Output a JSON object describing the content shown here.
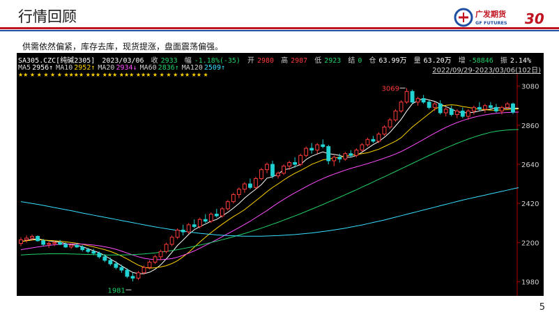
{
  "slide": {
    "title": "行情回顾",
    "summary": "供需依然偏紧，库存去库，现货提涨，盘面震荡偏强。",
    "page_number": "5",
    "logo_text": "广发期货",
    "logo_sub": "GF FUTURES",
    "logo_anniv": "30"
  },
  "quote": {
    "symbol": "SA305.CZC[纯碱2305]",
    "date": "2023/03/06",
    "close_label": "收",
    "close": "2933",
    "change_label": "幅",
    "change": "-1.18%(-35)",
    "open_label": "开",
    "open": "2980",
    "high_label": "高",
    "high": "2987",
    "low_label": "低",
    "low": "2923",
    "settle_label": "结",
    "settle": "0",
    "oi_label": "仓",
    "oi": "63.99万",
    "vol_label": "量",
    "vol": "63.20万",
    "diff_label": "增",
    "diff": "-58846",
    "amp_label": "振",
    "amp": "2.14%"
  },
  "ma_legend": [
    {
      "label": "MA5",
      "value": "2956↑",
      "color": "#ffffff"
    },
    {
      "label": "MA10",
      "value": "2952↑",
      "color": "#ffd400"
    },
    {
      "label": "MA20",
      "value": "2934↓",
      "color": "#ff4dff"
    },
    {
      "label": "MA60",
      "value": "2836↑",
      "color": "#22d36a"
    },
    {
      "label": "MA120",
      "value": "2509↑",
      "color": "#38e0ff"
    }
  ],
  "date_range": "2022/09/29-2023/03/06(102日)",
  "chart_data": {
    "type": "candlestick",
    "ylim": [
      1900,
      3110
    ],
    "y_ticks": [
      "3080",
      "2860",
      "2640",
      "2420",
      "2200",
      "1980"
    ],
    "annotations": [
      {
        "text": "3069",
        "index": 69,
        "value": 3069,
        "color": "#ff3b3b"
      },
      {
        "text": "1981",
        "index": 20,
        "value": 1981,
        "color": "#22d36a"
      }
    ],
    "up_color": "#ff3b3b",
    "down_color": "#22d3d3",
    "candles": [
      [
        2195,
        2230,
        2180,
        2215
      ],
      [
        2215,
        2240,
        2200,
        2225
      ],
      [
        2225,
        2245,
        2210,
        2235
      ],
      [
        2235,
        2240,
        2205,
        2210
      ],
      [
        2210,
        2220,
        2180,
        2190
      ],
      [
        2190,
        2205,
        2170,
        2195
      ],
      [
        2195,
        2210,
        2180,
        2200
      ],
      [
        2200,
        2215,
        2185,
        2190
      ],
      [
        2190,
        2200,
        2170,
        2175
      ],
      [
        2175,
        2190,
        2165,
        2185
      ],
      [
        2185,
        2195,
        2170,
        2175
      ],
      [
        2175,
        2185,
        2150,
        2160
      ],
      [
        2160,
        2170,
        2140,
        2150
      ],
      [
        2150,
        2165,
        2130,
        2140
      ],
      [
        2140,
        2150,
        2110,
        2120
      ],
      [
        2120,
        2135,
        2090,
        2100
      ],
      [
        2100,
        2115,
        2070,
        2080
      ],
      [
        2080,
        2095,
        2050,
        2060
      ],
      [
        2060,
        2075,
        2030,
        2045
      ],
      [
        2045,
        2055,
        2000,
        2010
      ],
      [
        2010,
        2030,
        1981,
        2000
      ],
      [
        2000,
        2040,
        1990,
        2030
      ],
      [
        2030,
        2070,
        2020,
        2060
      ],
      [
        2060,
        2100,
        2050,
        2090
      ],
      [
        2090,
        2130,
        2080,
        2120
      ],
      [
        2120,
        2160,
        2100,
        2150
      ],
      [
        2150,
        2200,
        2140,
        2190
      ],
      [
        2190,
        2240,
        2180,
        2230
      ],
      [
        2230,
        2280,
        2220,
        2270
      ],
      [
        2270,
        2300,
        2240,
        2260
      ],
      [
        2260,
        2310,
        2250,
        2300
      ],
      [
        2300,
        2330,
        2280,
        2290
      ],
      [
        2290,
        2340,
        2280,
        2330
      ],
      [
        2330,
        2360,
        2310,
        2320
      ],
      [
        2320,
        2370,
        2310,
        2360
      ],
      [
        2360,
        2390,
        2340,
        2350
      ],
      [
        2350,
        2400,
        2340,
        2390
      ],
      [
        2390,
        2440,
        2380,
        2430
      ],
      [
        2430,
        2480,
        2420,
        2470
      ],
      [
        2470,
        2510,
        2450,
        2500
      ],
      [
        2500,
        2540,
        2480,
        2530
      ],
      [
        2530,
        2560,
        2500,
        2510
      ],
      [
        2510,
        2570,
        2500,
        2560
      ],
      [
        2560,
        2620,
        2550,
        2610
      ],
      [
        2610,
        2650,
        2590,
        2640
      ],
      [
        2640,
        2660,
        2560,
        2575
      ],
      [
        2575,
        2600,
        2560,
        2590
      ],
      [
        2590,
        2640,
        2580,
        2630
      ],
      [
        2630,
        2660,
        2610,
        2650
      ],
      [
        2650,
        2680,
        2620,
        2640
      ],
      [
        2640,
        2700,
        2630,
        2690
      ],
      [
        2690,
        2740,
        2680,
        2730
      ],
      [
        2730,
        2760,
        2700,
        2720
      ],
      [
        2720,
        2760,
        2700,
        2750
      ],
      [
        2750,
        2780,
        2730,
        2740
      ],
      [
        2740,
        2750,
        2640,
        2660
      ],
      [
        2660,
        2690,
        2630,
        2680
      ],
      [
        2680,
        2700,
        2650,
        2670
      ],
      [
        2670,
        2710,
        2660,
        2700
      ],
      [
        2700,
        2720,
        2680,
        2690
      ],
      [
        2690,
        2730,
        2680,
        2720
      ],
      [
        2720,
        2760,
        2710,
        2750
      ],
      [
        2750,
        2790,
        2740,
        2780
      ],
      [
        2780,
        2800,
        2760,
        2770
      ],
      [
        2770,
        2820,
        2760,
        2810
      ],
      [
        2810,
        2860,
        2800,
        2850
      ],
      [
        2850,
        2900,
        2840,
        2890
      ],
      [
        2890,
        2950,
        2880,
        2940
      ],
      [
        2940,
        3000,
        2930,
        2990
      ],
      [
        2990,
        3069,
        2980,
        3050
      ],
      [
        3050,
        3060,
        2980,
        2990
      ],
      [
        2990,
        3020,
        2970,
        3010
      ],
      [
        3010,
        3030,
        2980,
        2990
      ],
      [
        2990,
        3000,
        2950,
        2960
      ],
      [
        2960,
        2990,
        2940,
        2980
      ],
      [
        2980,
        3000,
        2920,
        2930
      ],
      [
        2930,
        2960,
        2910,
        2950
      ],
      [
        2950,
        2970,
        2910,
        2920
      ],
      [
        2920,
        2950,
        2900,
        2940
      ],
      [
        2940,
        2960,
        2900,
        2910
      ],
      [
        2910,
        2950,
        2890,
        2940
      ],
      [
        2940,
        2970,
        2920,
        2960
      ],
      [
        2960,
        2990,
        2940,
        2950
      ],
      [
        2950,
        2980,
        2930,
        2970
      ],
      [
        2970,
        2990,
        2950,
        2960
      ],
      [
        2960,
        2980,
        2930,
        2940
      ],
      [
        2940,
        2970,
        2920,
        2960
      ],
      [
        2960,
        2990,
        2950,
        2980
      ],
      [
        2980,
        2987,
        2923,
        2933
      ]
    ],
    "ma": {
      "MA5": {
        "color": "#ffffff",
        "values": [
          2205,
          2212,
          2218,
          2221,
          2215,
          2210,
          2206,
          2202,
          2194,
          2188,
          2185,
          2177,
          2165,
          2154,
          2143,
          2127,
          2108,
          2089,
          2069,
          2050,
          2032,
          2025,
          2025,
          2033,
          2050,
          2075,
          2108,
          2145,
          2184,
          2214,
          2246,
          2272,
          2290,
          2304,
          2320,
          2330,
          2350,
          2370,
          2394,
          2420,
          2450,
          2476,
          2500,
          2526,
          2562,
          2570,
          2585,
          2610,
          2615,
          2627,
          2639,
          2667,
          2686,
          2698,
          2710,
          2700,
          2696,
          2690,
          2680,
          2680,
          2690,
          2708,
          2730,
          2751,
          2768,
          2792,
          2820,
          2856,
          2893,
          2940,
          2981,
          2998,
          3010,
          3002,
          2994,
          2979,
          2965,
          2951,
          2936,
          2931,
          2930,
          2933,
          2940,
          2946,
          2950,
          2960,
          2956,
          2956,
          2956,
          2956
        ]
      },
      "MA10": {
        "color": "#ffd400",
        "values": [
          2205,
          2210,
          2214,
          2216,
          2214,
          2212,
          2210,
          2208,
          2204,
          2200,
          2196,
          2190,
          2183,
          2176,
          2168,
          2160,
          2150,
          2138,
          2124,
          2108,
          2090,
          2073,
          2061,
          2056,
          2058,
          2063,
          2070,
          2082,
          2098,
          2120,
          2145,
          2174,
          2203,
          2230,
          2256,
          2280,
          2303,
          2325,
          2346,
          2365,
          2385,
          2410,
          2435,
          2460,
          2486,
          2510,
          2530,
          2552,
          2572,
          2590,
          2605,
          2622,
          2640,
          2652,
          2665,
          2670,
          2675,
          2680,
          2686,
          2692,
          2695,
          2700,
          2705,
          2715,
          2725,
          2740,
          2755,
          2770,
          2790,
          2820,
          2850,
          2875,
          2900,
          2925,
          2950,
          2965,
          2972,
          2975,
          2972,
          2965,
          2960,
          2955,
          2950,
          2947,
          2945,
          2944,
          2946,
          2948,
          2950,
          2952
        ]
      },
      "MA20": {
        "color": "#ff4dff",
        "values": [
          2160,
          2165,
          2170,
          2175,
          2180,
          2184,
          2188,
          2190,
          2191,
          2192,
          2192,
          2191,
          2189,
          2186,
          2182,
          2176,
          2170,
          2162,
          2152,
          2141,
          2130,
          2120,
          2112,
          2107,
          2104,
          2104,
          2106,
          2110,
          2118,
          2128,
          2140,
          2153,
          2168,
          2184,
          2200,
          2216,
          2233,
          2250,
          2267,
          2284,
          2302,
          2320,
          2340,
          2360,
          2380,
          2402,
          2423,
          2443,
          2462,
          2480,
          2497,
          2514,
          2530,
          2546,
          2560,
          2573,
          2585,
          2596,
          2607,
          2617,
          2626,
          2635,
          2644,
          2654,
          2664,
          2675,
          2686,
          2698,
          2712,
          2728,
          2745,
          2762,
          2780,
          2798,
          2815,
          2832,
          2848,
          2862,
          2875,
          2886,
          2896,
          2905,
          2912,
          2918,
          2923,
          2927,
          2930,
          2932,
          2933,
          2934
        ]
      },
      "MA60": {
        "color": "#22d36a",
        "values": [
          2130,
          2132,
          2134,
          2135,
          2136,
          2137,
          2137,
          2137,
          2137,
          2136,
          2135,
          2134,
          2133,
          2132,
          2131,
          2130,
          2130,
          2130,
          2130,
          2131,
          2132,
          2134,
          2136,
          2139,
          2142,
          2146,
          2150,
          2155,
          2160,
          2166,
          2172,
          2179,
          2186,
          2193,
          2200,
          2208,
          2216,
          2224,
          2233,
          2242,
          2251,
          2261,
          2271,
          2281,
          2292,
          2303,
          2314,
          2326,
          2338,
          2350,
          2362,
          2375,
          2388,
          2401,
          2414,
          2428,
          2441,
          2455,
          2469,
          2483,
          2497,
          2512,
          2526,
          2541,
          2556,
          2570,
          2585,
          2600,
          2615,
          2630,
          2645,
          2660,
          2675,
          2690,
          2704,
          2718,
          2732,
          2745,
          2758,
          2770,
          2782,
          2793,
          2803,
          2812,
          2820,
          2826,
          2830,
          2833,
          2835,
          2836
        ]
      },
      "MA120": {
        "color": "#38e0ff",
        "values": [
          2430,
          2425,
          2420,
          2415,
          2409,
          2403,
          2397,
          2391,
          2385,
          2379,
          2373,
          2366,
          2360,
          2354,
          2348,
          2342,
          2336,
          2330,
          2324,
          2318,
          2312,
          2306,
          2300,
          2294,
          2288,
          2283,
          2278,
          2273,
          2268,
          2264,
          2260,
          2256,
          2252,
          2249,
          2246,
          2243,
          2241,
          2239,
          2238,
          2237,
          2236,
          2236,
          2236,
          2236,
          2237,
          2238,
          2239,
          2241,
          2243,
          2245,
          2248,
          2251,
          2254,
          2258,
          2262,
          2266,
          2271,
          2276,
          2281,
          2287,
          2293,
          2299,
          2306,
          2313,
          2320,
          2327,
          2335,
          2343,
          2351,
          2359,
          2367,
          2375,
          2383,
          2391,
          2399,
          2407,
          2415,
          2423,
          2431,
          2439,
          2446,
          2453,
          2460,
          2467,
          2474,
          2481,
          2488,
          2495,
          2502,
          2509
        ]
      }
    },
    "star_rows": "★★  ★     ★     ★     ★         ★     ★★★★     ★★★    ★★★    ★★★          ★★★     ★      ★            ★         ★         ★★   ★★   ★"
  }
}
